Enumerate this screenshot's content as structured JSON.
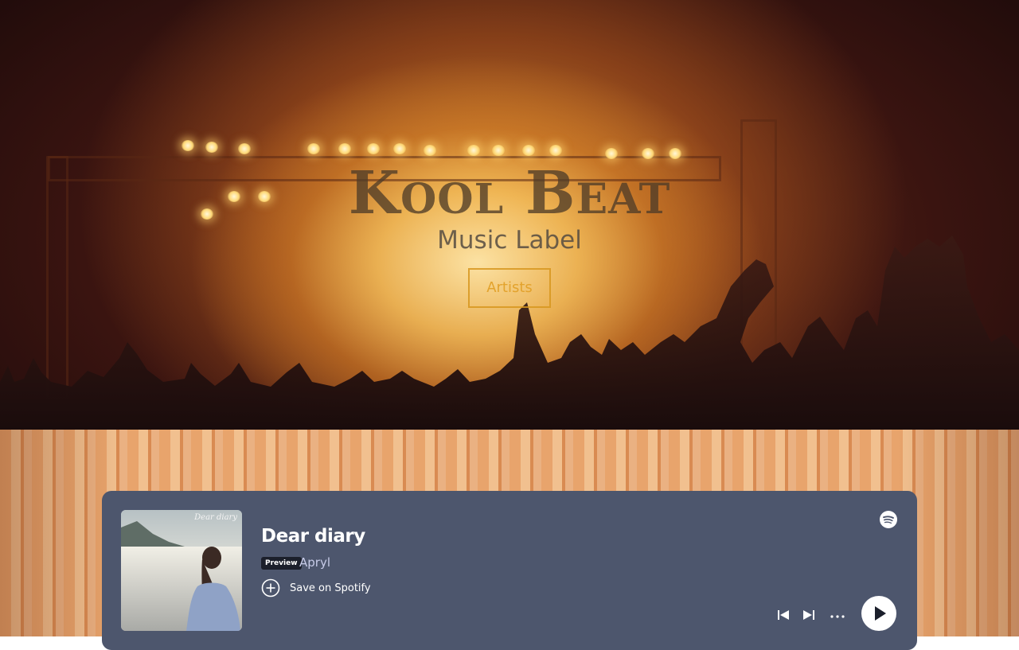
{
  "hero": {
    "title": "Kool Beat",
    "subtitle": "Music Label",
    "button_label": "Artists"
  },
  "embed": {
    "cover_title": "Dear diary",
    "track_title": "Dear diary",
    "preview_badge": "Preview",
    "artist": "Apryl",
    "save_label": "Save on Spotify",
    "icons": {
      "spotify": "spotify-logo-icon",
      "save": "add-circle-icon",
      "prev": "skip-back-icon",
      "next": "skip-forward-icon",
      "more": "more-horizontal-icon",
      "play": "play-icon"
    },
    "colors": {
      "background": "#4d566d",
      "badge": "#1b1f2b",
      "artist": "#c7cbe8"
    }
  },
  "colors": {
    "hero_button": "#d7961e",
    "stripe_light": "#f1c08f",
    "stripe_dark": "#e8a46c"
  }
}
